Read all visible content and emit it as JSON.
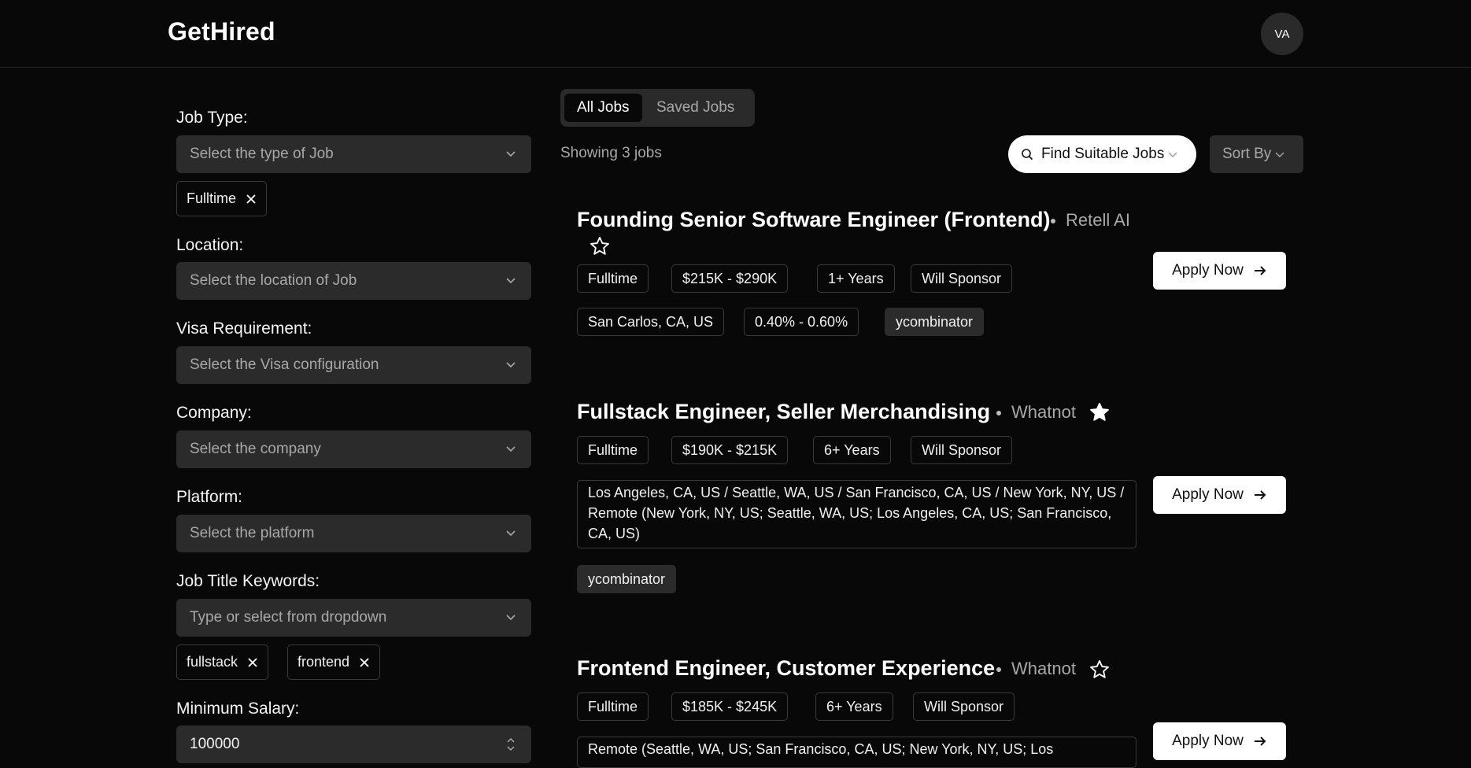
{
  "app": {
    "brand": "GetHired",
    "avatar_initials": "VA"
  },
  "filters": {
    "job_type": {
      "label": "Job Type:",
      "placeholder": "Select the type of Job",
      "chips": [
        "Fulltime"
      ]
    },
    "location": {
      "label": "Location:",
      "placeholder": "Select the location of Job"
    },
    "visa": {
      "label": "Visa Requirement:",
      "placeholder": "Select the Visa configuration"
    },
    "company": {
      "label": "Company:",
      "placeholder": "Select the company"
    },
    "platform": {
      "label": "Platform:",
      "placeholder": "Select the platform"
    },
    "keywords": {
      "label": "Job Title Keywords:",
      "placeholder": "Type or select from dropdown",
      "chips": [
        "fullstack",
        "frontend"
      ]
    },
    "min_salary": {
      "label": "Minimum Salary:",
      "value": "100000"
    }
  },
  "tabs": [
    {
      "label": "All Jobs",
      "active": true
    },
    {
      "label": "Saved Jobs",
      "active": false
    }
  ],
  "results": {
    "showing": "Showing 3 jobs",
    "find_label": "Find Suitable Jobs",
    "sort_label": "Sort By"
  },
  "jobs": [
    {
      "title": "Founding Senior Software Engineer (Frontend)",
      "company": "Retell AI",
      "saved": false,
      "tags": [
        "Fulltime",
        "$215K - $290K",
        "1+ Years",
        "Will Sponsor"
      ],
      "location": "San Carlos, CA, US",
      "equity": "0.40% - 0.60%",
      "source": "ycombinator",
      "apply_label": "Apply Now"
    },
    {
      "title": "Fullstack Engineer, Seller Merchandising",
      "company": "Whatnot",
      "saved": true,
      "tags": [
        "Fulltime",
        "$190K - $215K",
        "6+ Years",
        "Will Sponsor"
      ],
      "location": "Los Angeles, CA, US / Seattle, WA, US / San Francisco, CA, US / New York, NY, US / Remote (New York, NY, US; Seattle, WA, US; Los Angeles, CA, US; San Francisco, CA, US)",
      "source": "ycombinator",
      "apply_label": "Apply Now"
    },
    {
      "title": "Frontend Engineer, Customer Experience",
      "company": "Whatnot",
      "saved": false,
      "tags": [
        "Fulltime",
        "$185K - $245K",
        "6+ Years",
        "Will Sponsor"
      ],
      "location": "Remote (Seattle, WA, US; San Francisco, CA, US; New York, NY, US; Los",
      "apply_label": "Apply Now"
    }
  ]
}
